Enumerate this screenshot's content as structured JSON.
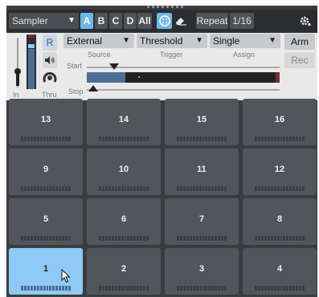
{
  "toolbar": {
    "mode_dropdown": "Sampler",
    "banks": [
      "A",
      "B",
      "C",
      "D",
      "All"
    ],
    "active_bank": "A",
    "repeat_label": "Repeat",
    "repeat_rate": "1/16"
  },
  "sampler": {
    "r_label": "R",
    "in_label": "In",
    "thru_label": "Thru",
    "source_label": "Source",
    "trigger_label": "Trigger",
    "assign_label": "Assign",
    "source_value": "External",
    "trigger_value": "Threshold",
    "assign_value": "Single",
    "start_label": "Start",
    "stop_label": "Stop",
    "arm_label": "Arm",
    "rec_label": "Rec"
  },
  "pads": {
    "row1": [
      "13",
      "14",
      "15",
      "16"
    ],
    "row2": [
      "9",
      "10",
      "11",
      "12"
    ],
    "row3": [
      "5",
      "6",
      "7",
      "8"
    ],
    "row4": [
      "1",
      "2",
      "3",
      "4"
    ],
    "selected": "1"
  },
  "colors": {
    "accent": "#6fb8ee",
    "selected_pad": "#8fcaf6",
    "pad": "#52565b",
    "background": "#3a3d40"
  }
}
